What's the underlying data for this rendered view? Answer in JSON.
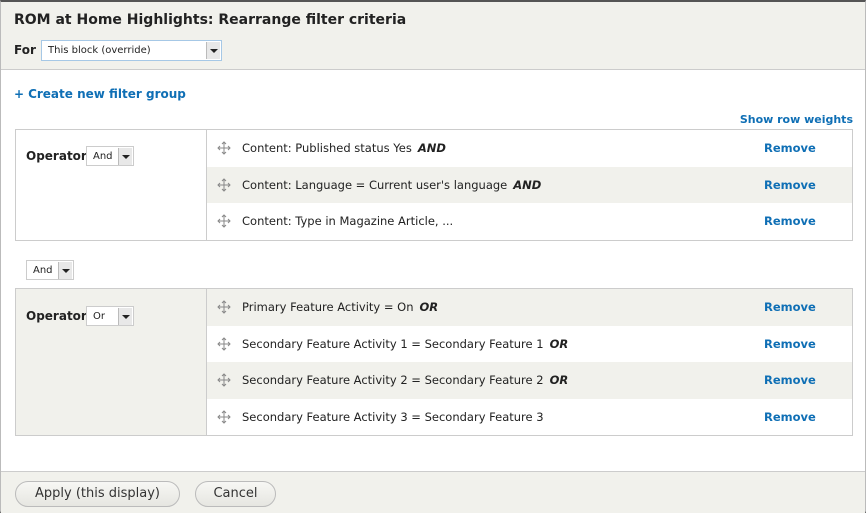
{
  "dialog": {
    "title": "ROM at Home Highlights: Rearrange filter criteria",
    "for_label": "For",
    "for_select": {
      "value": "This block (override)"
    }
  },
  "actions": {
    "create_group": {
      "icon": "plus-icon",
      "label": "Create new filter group"
    },
    "show_row_weights": "Show row weights"
  },
  "groups": [
    {
      "operator_label": "Operator",
      "operator_value": "And",
      "filters": [
        {
          "text": "Content: Published status Yes",
          "conj": "AND",
          "remove": "Remove"
        },
        {
          "text": "Content: Language = Current user's language",
          "conj": "AND",
          "remove": "Remove"
        },
        {
          "text": "Content: Type in Magazine Article, ...",
          "conj": "",
          "remove": "Remove"
        }
      ]
    },
    {
      "operator_label": "Operator",
      "operator_value": "Or",
      "filters": [
        {
          "text": "Primary Feature Activity = On",
          "conj": "OR",
          "remove": "Remove"
        },
        {
          "text": "Secondary Feature Activity 1 = Secondary Feature 1",
          "conj": "OR",
          "remove": "Remove"
        },
        {
          "text": "Secondary Feature Activity 2 = Secondary Feature 2",
          "conj": "OR",
          "remove": "Remove"
        },
        {
          "text": "Secondary Feature Activity 3 = Secondary Feature 3",
          "conj": "",
          "remove": "Remove"
        }
      ]
    }
  ],
  "between_groups_operator": "And",
  "footer": {
    "apply_label": "Apply (this display)",
    "cancel_label": "Cancel"
  },
  "colors": {
    "link": "#0f6fb5",
    "panel_bg": "#f1f1ec",
    "border": "#cccccc"
  }
}
